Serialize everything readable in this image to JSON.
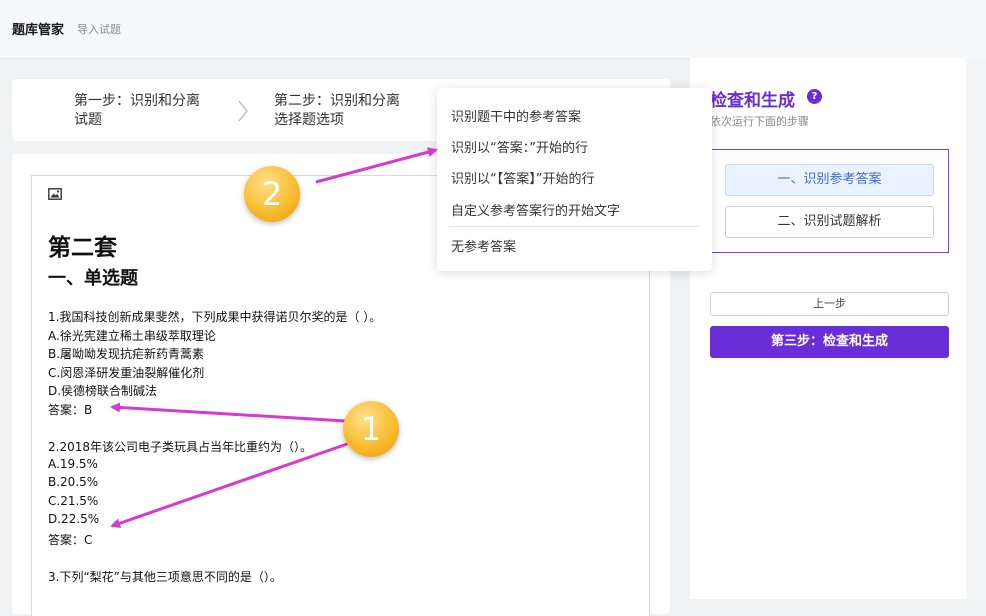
{
  "header": {
    "title": "题库管家",
    "subtitle": "导入试题"
  },
  "steps": {
    "step1": [
      "第一步：识别和分离",
      "试题"
    ],
    "step2": [
      "第二步：识别和分离",
      "选择题选项"
    ]
  },
  "document": {
    "heading1": "第二套",
    "heading2": "一、单选题",
    "lines": [
      "1.我国科技创新成果斐然，下列成果中获得诺贝尔奖的是（  ）。",
      "A.徐光宪建立稀土串级萃取理论",
      "B.屠呦呦发现抗疟新药青蒿素",
      "C.闵恩泽研发重油裂解催化剂",
      "D.侯德榜联合制碱法",
      "答案：B",
      "2.2018年该公司电子类玩具占当年比重约为（）。",
      "A.19.5%",
      "B.20.5%",
      "C.21.5%",
      "D.22.5%",
      "答案：C",
      "3.下列“梨花”与其他三项意思不同的是（）。"
    ]
  },
  "dropdown": {
    "items": [
      "识别题干中的参考答案",
      "识别以“答案：”开始的行",
      "识别以“【答案】”开始的行",
      "自定义参考答案行的开始文字",
      "无参考答案"
    ]
  },
  "right_panel": {
    "title": "检查和生成",
    "help": "?",
    "subtitle": "依次运行下面的步骤",
    "step_a": "一、识别参考答案",
    "step_b": "二、识别试题解析",
    "prev_label": "上一步",
    "next_label": "第三步：检查和生成"
  },
  "annotations": {
    "badge1": "1",
    "badge2": "2"
  },
  "colors": {
    "accent": "#6a2ed8",
    "arrow": "#d63ad0",
    "badge": "#f7b92a"
  }
}
